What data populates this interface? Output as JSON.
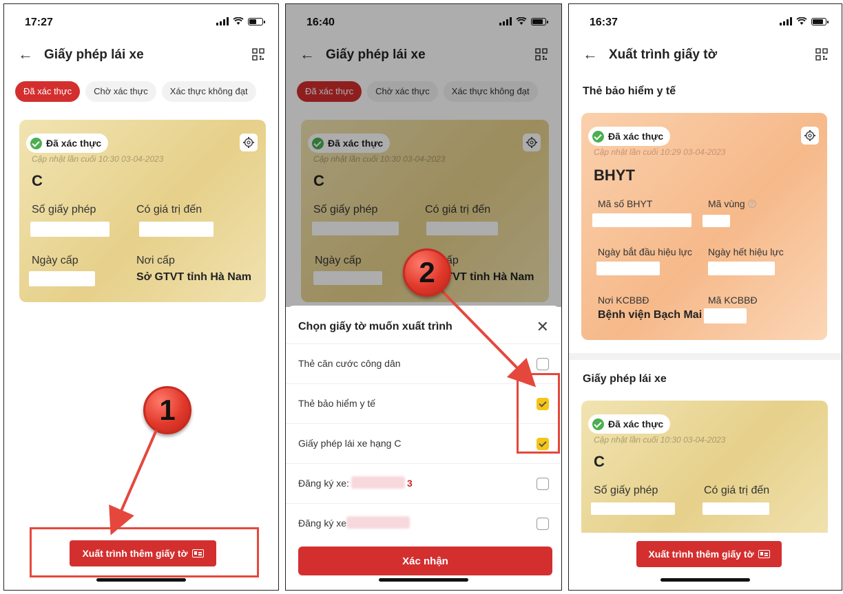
{
  "phone1": {
    "time": "17:27",
    "title": "Giấy phép lái xe",
    "tabs": [
      "Đã xác thực",
      "Chờ xác thực",
      "Xác thực không đạt"
    ],
    "card": {
      "badge": "Đã xác thực",
      "updated": "Cập nhật lần cuối 10:30 03-04-2023",
      "class": "C",
      "license_no_label": "Số giấy phép",
      "valid_to_label": "Có giá trị đến",
      "issue_date_label": "Ngày cấp",
      "issued_by_label": "Nơi cấp",
      "issued_by_value": "Sở GTVT tỉnh Hà Nam"
    },
    "button": "Xuất trình thêm giấy tờ",
    "callout": "1"
  },
  "phone2": {
    "time": "16:40",
    "title": "Giấy phép lái xe",
    "tabs": [
      "Đã xác thực",
      "Chờ xác thực",
      "Xác thực không đạt"
    ],
    "card": {
      "badge": "Đã xác thực",
      "updated": "Cập nhật lần cuối 10:30 03-04-2023",
      "class": "C",
      "license_no_label": "Số giấy phép",
      "valid_to_label": "Có giá trị đến",
      "issue_date_label": "Ngày cấp",
      "issued_by_label": "cấp",
      "issued_by_value": "GTVT tỉnh Hà Nam"
    },
    "sheet": {
      "title": "Chọn giấy tờ muốn xuất trình",
      "options": [
        {
          "label": "Thẻ căn cước công dân",
          "checked": false
        },
        {
          "label": "Thẻ bảo hiểm y tế",
          "checked": true
        },
        {
          "label": "Giấy phép lái xe hạng C",
          "checked": true
        },
        {
          "label": "Đăng ký xe:",
          "checked": false,
          "tail": "3"
        },
        {
          "label": "Đăng ký xe",
          "checked": false
        }
      ],
      "confirm": "Xác nhận"
    },
    "callout": "2"
  },
  "phone3": {
    "time": "16:37",
    "title": "Xuất trình giấy tờ",
    "section1": "Thẻ bảo hiểm y tế",
    "bhyt": {
      "badge": "Đã xác thực",
      "updated": "Cập nhật lần cuối 10:29 03-04-2023",
      "name": "BHYT",
      "code_label": "Mã số BHYT",
      "region_label": "Mã vùng",
      "start_label": "Ngày bắt đầu hiệu lực",
      "end_label": "Ngày hết hiệu lực",
      "place_label": "Nơi KCBBĐ",
      "place_value": "Bệnh viện Bạch Mai",
      "place_code_label": "Mã KCBBĐ"
    },
    "section2": "Giấy phép lái xe",
    "license": {
      "badge": "Đã xác thực",
      "updated": "Cập nhật lần cuối 10:30 03-04-2023",
      "class": "C",
      "license_no_label": "Số giấy phép",
      "valid_to_label": "Có giá trị đến"
    },
    "button": "Xuất trình thêm giấy tờ"
  }
}
